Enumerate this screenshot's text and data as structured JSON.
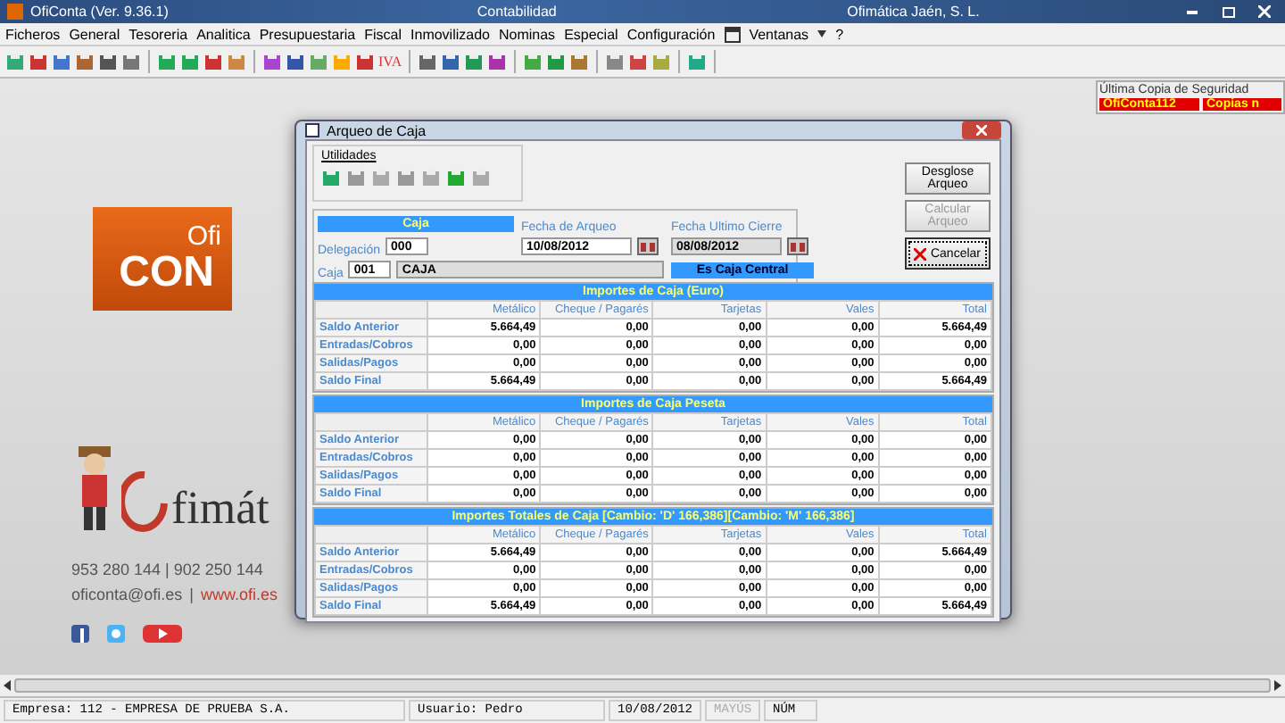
{
  "window": {
    "title": "OfiConta (Ver. 9.36.1)",
    "center_title": "Contabilidad",
    "company": "Ofimática Jaén, S. L."
  },
  "menu": [
    "Ficheros",
    "General",
    "Tesoreria",
    "Analitica",
    "Presupuestaria",
    "Fiscal",
    "Inmovilizado",
    "Nominas",
    "Especial",
    "Configuración"
  ],
  "window_menu": "Ventanas",
  "help_menu": "?",
  "toolbar_text": "IVA",
  "brand": {
    "ofi": "Ofi",
    "con": "CON",
    "ofimatica": "fimát",
    "phones": "953 280 144  |  902 250 144",
    "email": "oficonta@ofi.es",
    "separator": "|",
    "web": "www.ofi.es"
  },
  "backup": {
    "title": "Última Copia de Seguridad",
    "name": "OfiConta112",
    "copies": "Copias n"
  },
  "dialog": {
    "title": "Arqueo de Caja",
    "utilities_label": "Utilidades",
    "caja_header": "Caja",
    "delegacion_label": "Delegación",
    "delegacion": "000",
    "caja_label": "Caja",
    "caja_code": "001",
    "caja_name": "CAJA",
    "fecha_arqueo_label": "Fecha de Arqueo",
    "fecha_arqueo": "10/08/2012",
    "fecha_cierre_label": "Fecha Ultimo Cierre",
    "fecha_cierre": "08/08/2012",
    "central": "Es Caja Central",
    "buttons": [
      {
        "kind": "plain",
        "label": "Desglose Arqueo",
        "disabled": false,
        "focused": false
      },
      {
        "kind": "plain",
        "label": "Calcular Arqueo",
        "disabled": true,
        "focused": false
      },
      {
        "kind": "cancel",
        "label": "Cancelar",
        "disabled": false,
        "focused": true
      }
    ],
    "tables": [
      {
        "title": "Importes de Caja (Euro)",
        "columns": [
          "Metálico",
          "Cheque / Pagarés",
          "Tarjetas",
          "Vales",
          "Total"
        ],
        "rows": [
          {
            "label": "Saldo Anterior",
            "values": [
              "5.664,49",
              "0,00",
              "0,00",
              "0,00",
              "5.664,49"
            ]
          },
          {
            "label": "Entradas/Cobros",
            "values": [
              "0,00",
              "0,00",
              "0,00",
              "0,00",
              "0,00"
            ]
          },
          {
            "label": "Salidas/Pagos",
            "values": [
              "0,00",
              "0,00",
              "0,00",
              "0,00",
              "0,00"
            ]
          },
          {
            "label": "Saldo Final",
            "values": [
              "5.664,49",
              "0,00",
              "0,00",
              "0,00",
              "5.664,49"
            ]
          }
        ]
      },
      {
        "title": "Importes de Caja  Peseta",
        "columns": [
          "Metálico",
          "Cheque / Pagarés",
          "Tarjetas",
          "Vales",
          "Total"
        ],
        "rows": [
          {
            "label": "Saldo Anterior",
            "values": [
              "0,00",
              "0,00",
              "0,00",
              "0,00",
              "0,00"
            ]
          },
          {
            "label": "Entradas/Cobros",
            "values": [
              "0,00",
              "0,00",
              "0,00",
              "0,00",
              "0,00"
            ]
          },
          {
            "label": "Salidas/Pagos",
            "values": [
              "0,00",
              "0,00",
              "0,00",
              "0,00",
              "0,00"
            ]
          },
          {
            "label": "Saldo Final",
            "values": [
              "0,00",
              "0,00",
              "0,00",
              "0,00",
              "0,00"
            ]
          }
        ]
      },
      {
        "title": "Importes Totales de Caja [Cambio: 'D' 166,386][Cambio: 'M' 166,386]",
        "columns": [
          "Metálico",
          "Cheque / Pagarés",
          "Tarjetas",
          "Vales",
          "Total"
        ],
        "rows": [
          {
            "label": "Saldo Anterior",
            "values": [
              "5.664,49",
              "0,00",
              "0,00",
              "0,00",
              "5.664,49"
            ]
          },
          {
            "label": "Entradas/Cobros",
            "values": [
              "0,00",
              "0,00",
              "0,00",
              "0,00",
              "0,00"
            ]
          },
          {
            "label": "Salidas/Pagos",
            "values": [
              "0,00",
              "0,00",
              "0,00",
              "0,00",
              "0,00"
            ]
          },
          {
            "label": "Saldo Final",
            "values": [
              "5.664,49",
              "0,00",
              "0,00",
              "0,00",
              "5.664,49"
            ]
          }
        ]
      }
    ]
  },
  "status_bar": [
    {
      "text": "Empresa: 112 - EMPRESA DE PRUEBA S.A.",
      "disabled": false
    },
    {
      "text": "Usuario: Pedro",
      "disabled": false
    },
    {
      "text": "10/08/2012",
      "disabled": false
    },
    {
      "text": "MAYÚS",
      "disabled": true
    },
    {
      "text": "NÚM",
      "disabled": false
    }
  ]
}
